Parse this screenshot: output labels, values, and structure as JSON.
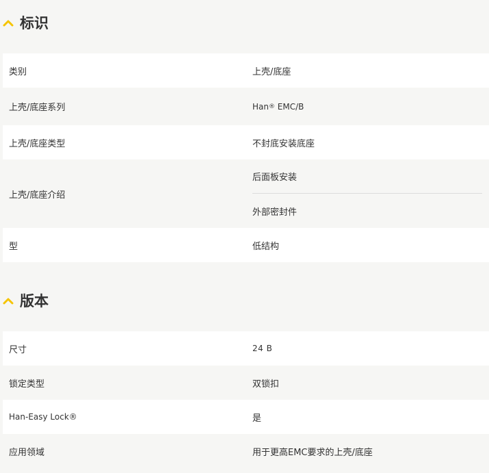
{
  "accent_color": "#f5c400",
  "sections": {
    "identification": {
      "icon": "chevron-up-icon",
      "title": "标识",
      "rows": [
        {
          "label": "类别",
          "value": "上壳/底座"
        },
        {
          "label": "上壳/底座系列",
          "value_main": "Han",
          "value_sup": "®",
          "value_rest": " EMC/B"
        },
        {
          "label": "上壳/底座类型",
          "value": "不封底安装底座"
        },
        {
          "label": "上壳/底座介绍",
          "values": [
            "后面板安装",
            "外部密封件"
          ]
        },
        {
          "label": "型",
          "value": "低结构"
        }
      ]
    },
    "version": {
      "icon": "chevron-up-icon",
      "title": "版本",
      "rows": [
        {
          "label": "尺寸",
          "value": "24 B"
        },
        {
          "label": "锁定类型",
          "value": "双锁扣"
        },
        {
          "label": "Han-Easy Lock®",
          "value": "是"
        },
        {
          "label": "应用领域",
          "value": "用于更高EMC要求的上壳/底座"
        }
      ]
    }
  }
}
